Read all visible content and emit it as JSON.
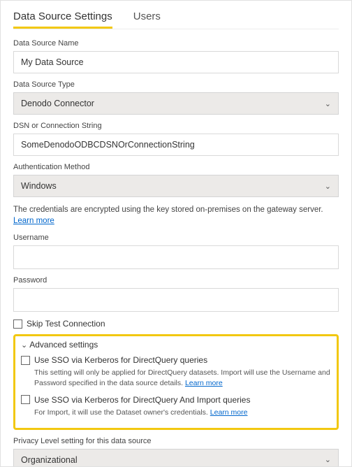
{
  "tabs": {
    "settings": "Data Source Settings",
    "users": "Users"
  },
  "labels": {
    "dsName": "Data Source Name",
    "dsType": "Data Source Type",
    "dsn": "DSN or Connection String",
    "auth": "Authentication Method",
    "username": "Username",
    "password": "Password",
    "privacy": "Privacy Level setting for this data source"
  },
  "values": {
    "dsName": "My Data Source",
    "dsType": "Denodo Connector",
    "dsn": "SomeDenodoODBCDSNOrConnectionString",
    "auth": "Windows",
    "privacy": "Organizational"
  },
  "info": {
    "encrypted": "The credentials are encrypted using the key stored on-premises on the gateway server.",
    "learnMore": "Learn more"
  },
  "skipTest": "Skip Test Connection",
  "advanced": {
    "title": "Advanced settings",
    "sso1": "Use SSO via Kerberos for DirectQuery queries",
    "sso1hint": "This setting will only be applied for DirectQuery datasets. Import will use the Username and Password specified in the data source details.",
    "sso2": "Use SSO via Kerberos for DirectQuery And Import queries",
    "sso2hint": "For Import, it will use the Dataset owner's credentials."
  }
}
